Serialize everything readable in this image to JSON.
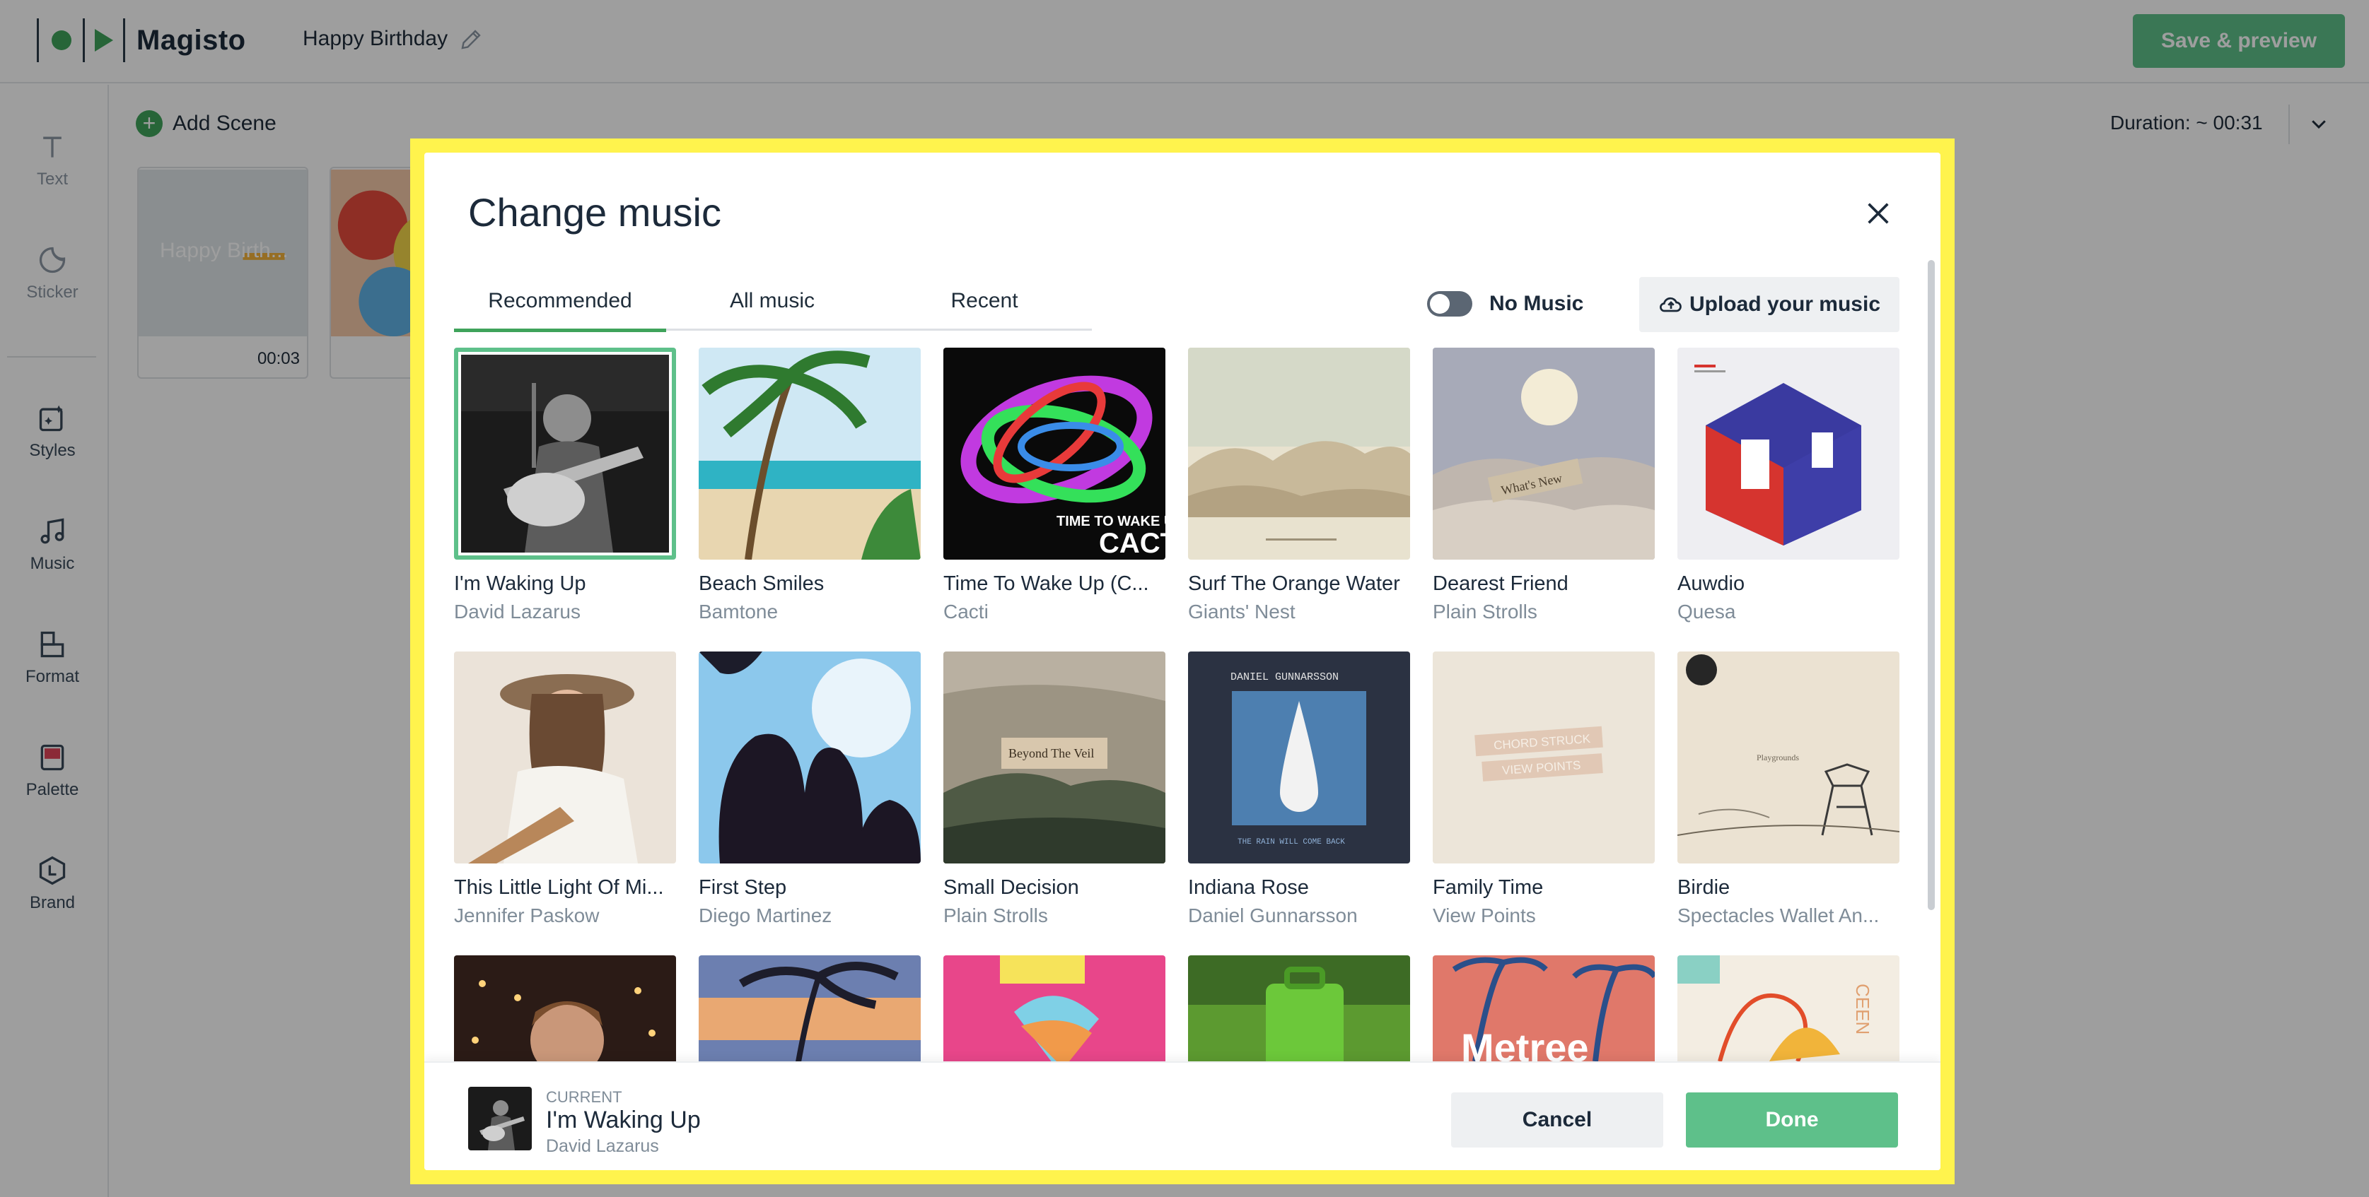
{
  "app": {
    "logo_text": "Magisto",
    "project_title": "Happy Birthday",
    "save_label": "Save & preview",
    "add_scene_label": "Add Scene",
    "duration_label": "Duration: ~ 00:31"
  },
  "sidebar": {
    "items": [
      {
        "label": "Text",
        "icon": "text-icon"
      },
      {
        "label": "Sticker",
        "icon": "sticker-icon"
      },
      {
        "label": "Styles",
        "icon": "styles-icon"
      },
      {
        "label": "Music",
        "icon": "music-icon"
      },
      {
        "label": "Format",
        "icon": "format-icon"
      },
      {
        "label": "Palette",
        "icon": "palette-icon"
      },
      {
        "label": "Brand",
        "icon": "brand-icon"
      }
    ]
  },
  "scenes": [
    {
      "overlay_text": "Happy Birth...",
      "time": "00:03"
    }
  ],
  "modal": {
    "title": "Change music",
    "tabs": [
      {
        "label": "Recommended",
        "active": true
      },
      {
        "label": "All music",
        "active": false
      },
      {
        "label": "Recent",
        "active": false
      }
    ],
    "no_music_label": "No Music",
    "no_music_on": false,
    "upload_label": "Upload your music",
    "tracks": [
      {
        "title": "I'm Waking Up",
        "artist": "David Lazarus",
        "selected": true
      },
      {
        "title": "Beach Smiles",
        "artist": "Bamtone"
      },
      {
        "title": "Time To Wake Up (C...",
        "artist": "Cacti"
      },
      {
        "title": "Surf The Orange Water",
        "artist": "Giants' Nest"
      },
      {
        "title": "Dearest Friend",
        "artist": "Plain Strolls"
      },
      {
        "title": "Auwdio",
        "artist": "Quesa"
      },
      {
        "title": "This Little Light Of Mi...",
        "artist": "Jennifer Paskow"
      },
      {
        "title": "First Step",
        "artist": "Diego Martinez"
      },
      {
        "title": "Small Decision",
        "artist": "Plain Strolls"
      },
      {
        "title": "Indiana Rose",
        "artist": "Daniel Gunnarsson"
      },
      {
        "title": "Family Time",
        "artist": "View Points"
      },
      {
        "title": "Birdie",
        "artist": "Spectacles Wallet An..."
      }
    ],
    "cover_text": {
      "cacti": "TIME TO WAKE UP",
      "cacti_big": "CACTI",
      "dearest": "What's New",
      "veil": "Beyond The Veil",
      "gunnarsson": "DANIEL GUNNARSSON",
      "gunnarsson_sub": "THE RAIN WILL COME BACK",
      "family": "CHORD STRUCK",
      "family_sub": "VIEW POINTS",
      "birdie": "Playgrounds",
      "metree": "Metree",
      "ceen": "CEEN"
    },
    "current": {
      "label": "CURRENT",
      "title": "I'm Waking Up",
      "artist": "David Lazarus"
    },
    "cancel_label": "Cancel",
    "done_label": "Done"
  },
  "colors": {
    "accent": "#5ec08a",
    "brand_green": "#3fa35b",
    "highlight": "#fff34d"
  }
}
